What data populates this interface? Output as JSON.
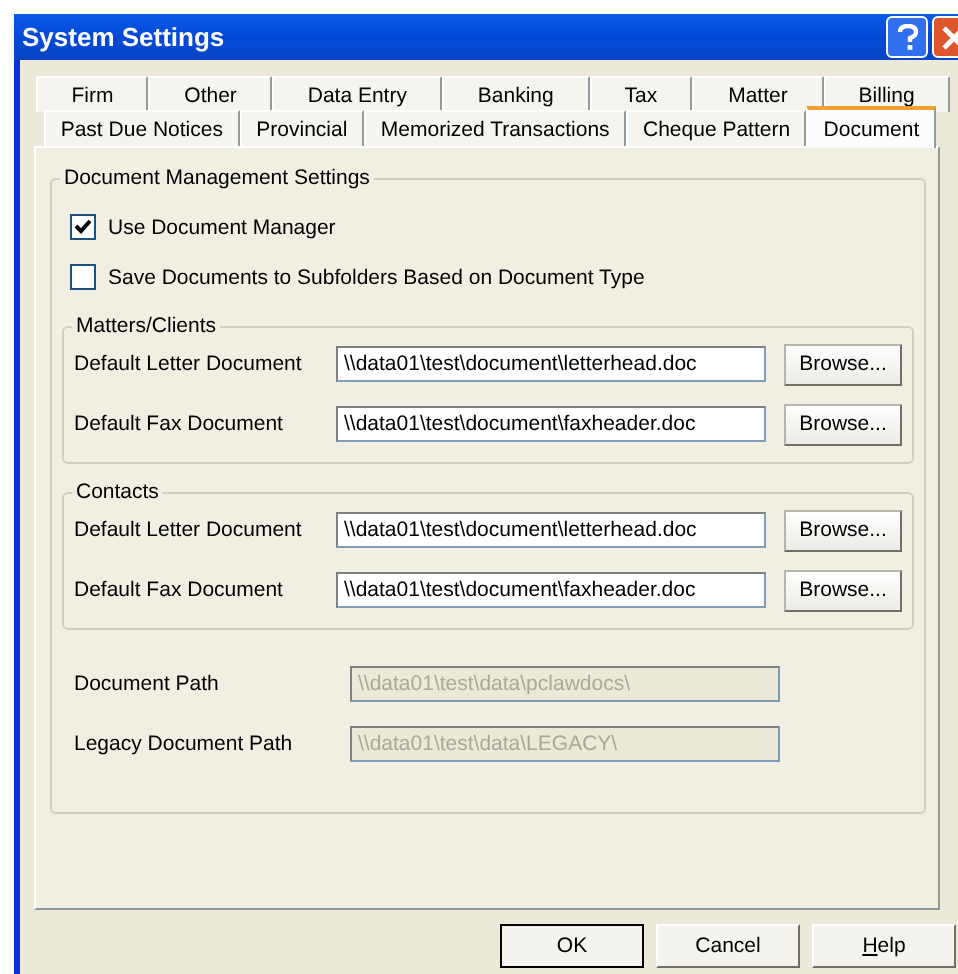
{
  "window": {
    "title": "System Settings"
  },
  "tab_rows": [
    [
      {
        "label": "Firm",
        "selected": false
      },
      {
        "label": "Other",
        "selected": false
      },
      {
        "label": "Data Entry",
        "selected": false
      },
      {
        "label": "Banking",
        "selected": false
      },
      {
        "label": "Tax",
        "selected": false
      },
      {
        "label": "Matter",
        "selected": false
      },
      {
        "label": "Billing",
        "selected": false
      }
    ],
    [
      {
        "label": "Past Due Notices",
        "selected": false
      },
      {
        "label": "Provincial",
        "selected": false
      },
      {
        "label": "Memorized Transactions",
        "selected": false
      },
      {
        "label": "Cheque Pattern",
        "selected": false
      },
      {
        "label": "Document",
        "selected": true
      }
    ]
  ],
  "settings_group": {
    "title": "Document Management Settings",
    "checkboxes": [
      {
        "label": "Use Document Manager",
        "checked": true
      },
      {
        "label": "Save Documents to Subfolders Based on Document Type",
        "checked": false
      }
    ],
    "subgroups": [
      {
        "title": "Matters/Clients",
        "rows": [
          {
            "label": "Default Letter Document",
            "value": "\\\\data01\\test\\document\\letterhead.doc",
            "button": "Browse..."
          },
          {
            "label": "Default Fax Document",
            "value": "\\\\data01\\test\\document\\faxheader.doc",
            "button": "Browse..."
          }
        ]
      },
      {
        "title": "Contacts",
        "rows": [
          {
            "label": "Default Letter Document",
            "value": "\\\\data01\\test\\document\\letterhead.doc",
            "button": "Browse..."
          },
          {
            "label": "Default Fax Document",
            "value": "\\\\data01\\test\\document\\faxheader.doc",
            "button": "Browse..."
          }
        ]
      }
    ],
    "paths": [
      {
        "label": "Document Path",
        "value": "\\\\data01\\test\\data\\pclawdocs\\",
        "disabled": true
      },
      {
        "label": "Legacy Document Path",
        "value": "\\\\data01\\test\\data\\LEGACY\\",
        "disabled": true
      }
    ]
  },
  "buttons": [
    {
      "label": "OK",
      "default": true
    },
    {
      "label": "Cancel",
      "default": false
    },
    {
      "label": "Help",
      "default": false
    }
  ]
}
